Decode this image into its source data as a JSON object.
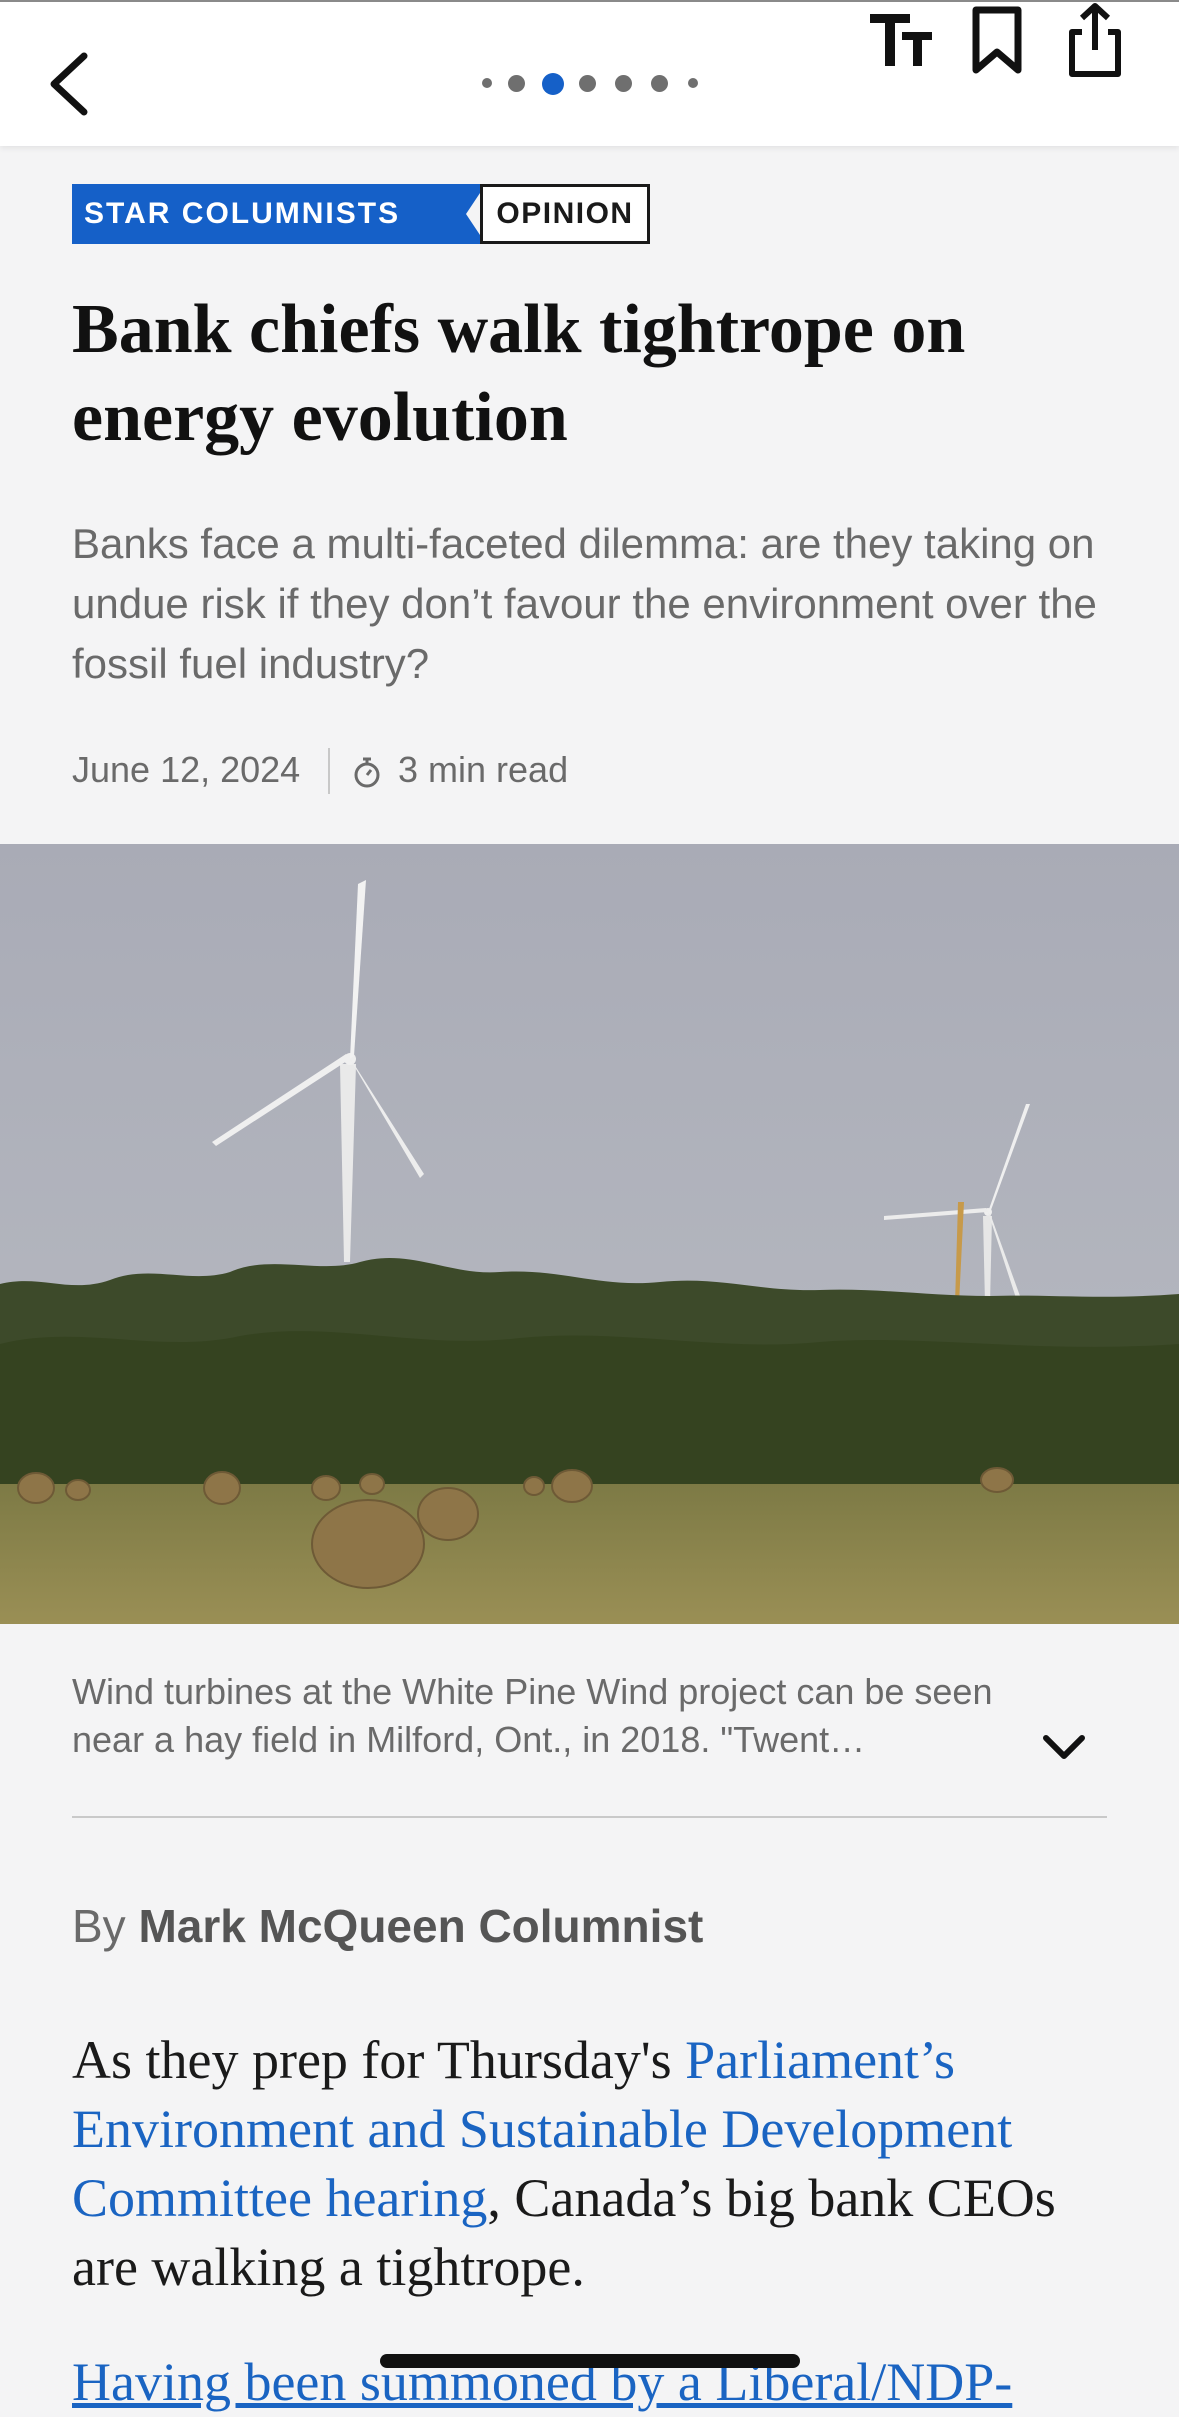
{
  "nav": {
    "back_icon": "chevron-left-icon",
    "pager": {
      "count": 7,
      "active_index": 2
    },
    "text_size_label": "Tт",
    "icons": [
      "text-size-icon",
      "bookmark-icon",
      "share-icon"
    ]
  },
  "tags": {
    "section": "STAR COLUMNISTS",
    "type": "OPINION"
  },
  "article": {
    "headline": "Bank chiefs walk tightrope on energy evolution",
    "dek": "Banks face a multi-faceted dilemma: are they taking on undue risk if they don’t favour the environment over the fossil fuel industry?",
    "date": "June 12, 2024",
    "read_time": "3 min read",
    "caption": "Wind turbines at the White Pine Wind project can be seen near a hay field in Milford, Ont., in 2018. \"Twent…",
    "byline_prefix": "By",
    "author": "Mark McQueen Columnist",
    "para1_start": "As they prep for Thursday's ",
    "para1_link": "Parliament’s Environment and Sustainable Development Committee hearing",
    "para1_end": ", Canada’s big bank CEOs are walking a tightrope.",
    "para2_link": "Having been summoned by a Liberal/NDP-"
  },
  "colors": {
    "accent": "#1560c8",
    "link": "#1a64c2",
    "background": "#f4f4f5"
  }
}
